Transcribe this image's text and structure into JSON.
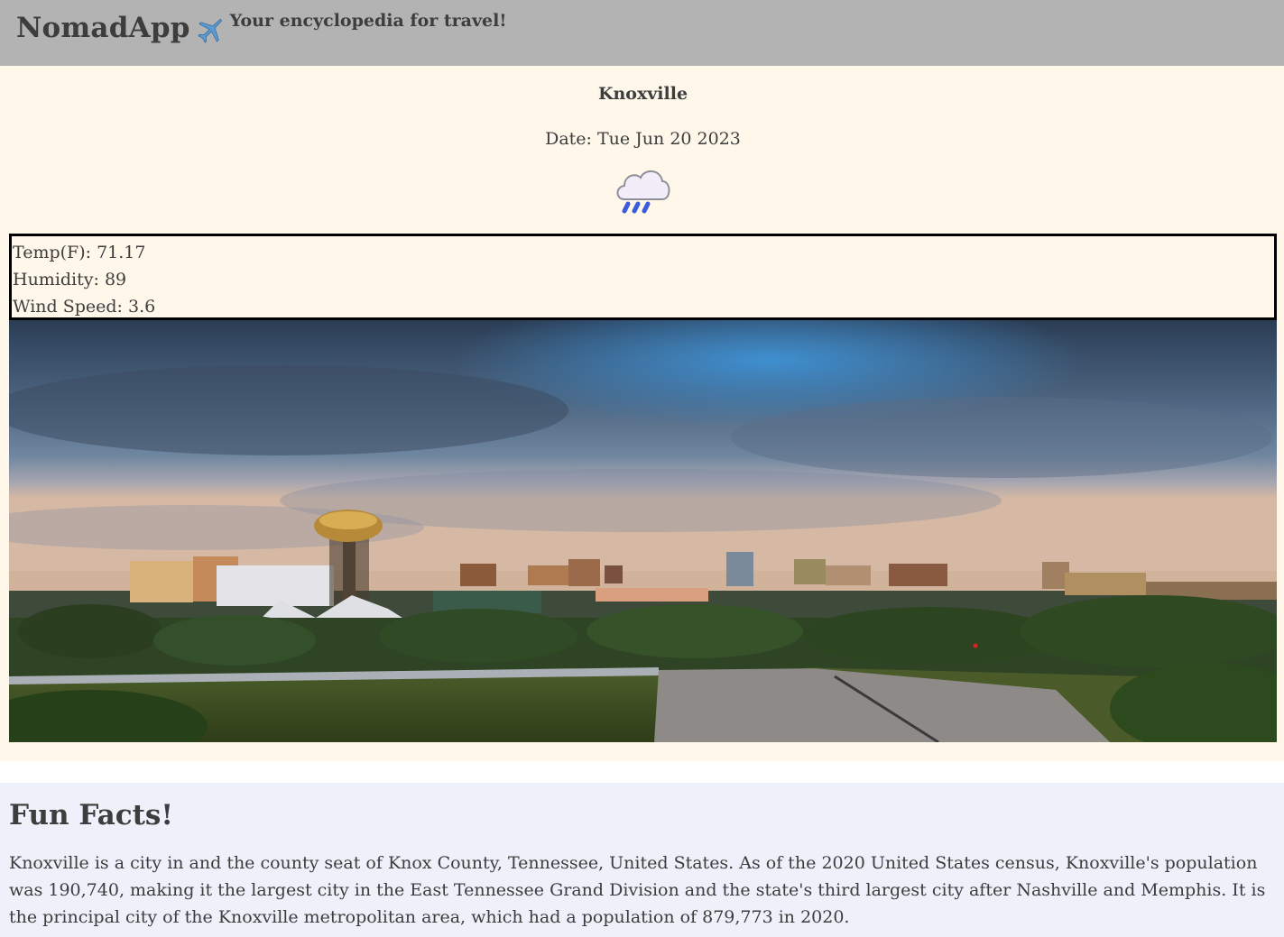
{
  "header": {
    "brand": "NomadApp",
    "plane_icon": "airplane-icon",
    "tagline": "Your encyclopedia for travel!"
  },
  "weather": {
    "city": "Knoxville",
    "date": "Date: Tue Jun 20 2023",
    "icon": "rain-cloud-icon",
    "temp": "Temp(F): 71.17",
    "humidity": "Humidity: 89",
    "wind": "Wind Speed: 3.6"
  },
  "facts": {
    "title": "Fun Facts!",
    "body": "Knoxville is a city in and the county seat of Knox County, Tennessee, United States. As of the 2020 United States census, Knoxville's population was 190,740, making it the largest city in the East Tennessee Grand Division and the state's third largest city after Nashville and Memphis. It is the principal city of the Knoxville metropolitan area, which had a population of 879,773 in 2020."
  },
  "colors": {
    "header_bg": "#b3b3b3",
    "weather_bg": "#fff8ea",
    "facts_bg": "#eef0fa",
    "text": "#3d3d3d"
  }
}
